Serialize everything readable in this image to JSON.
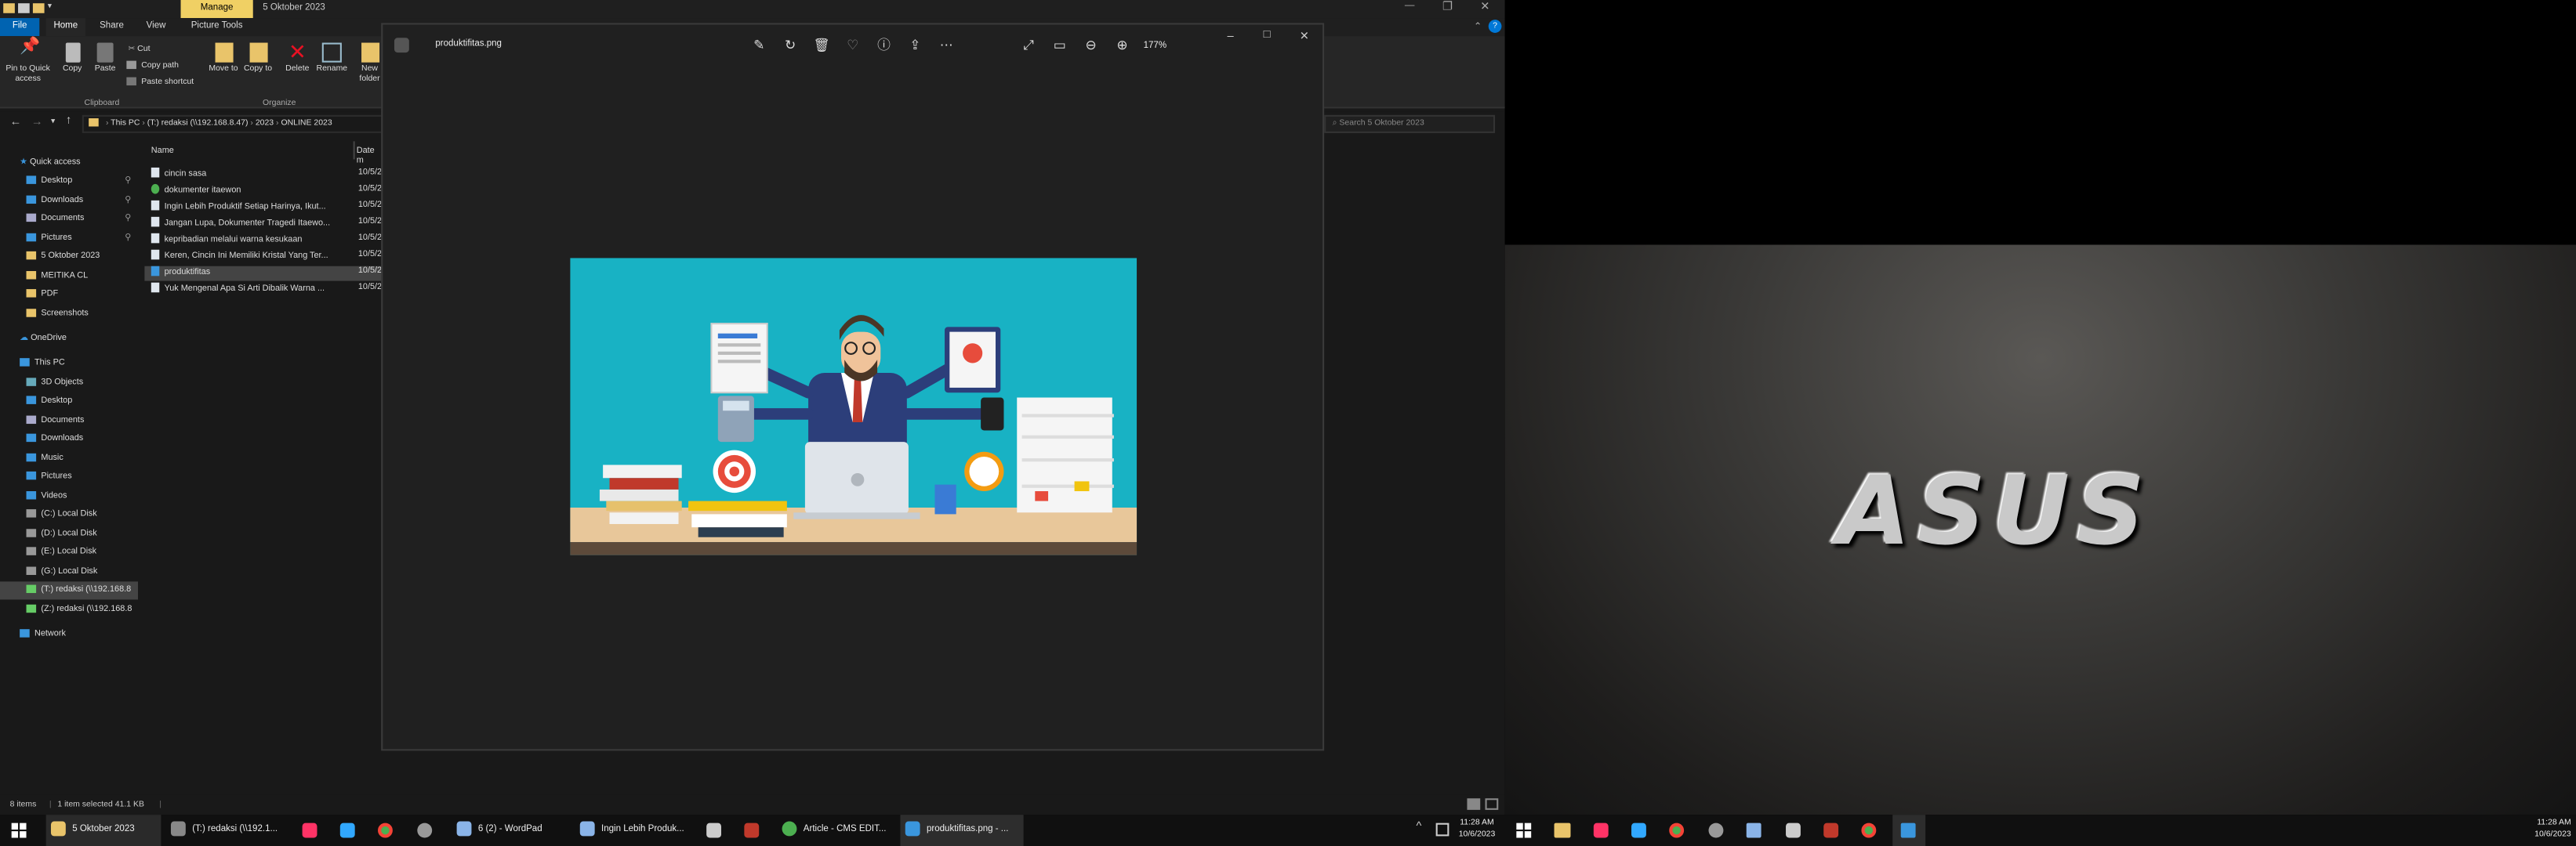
{
  "explorer": {
    "title": "5 Oktober 2023",
    "manage_tab": "Manage",
    "tabs": [
      "File",
      "Home",
      "Share",
      "View",
      "Picture Tools"
    ],
    "ribbon": {
      "pin": "Pin to Quick access",
      "copy": "Copy",
      "paste": "Paste",
      "cut": "Cut",
      "copy_path": "Copy path",
      "paste_shortcut": "Paste shortcut",
      "move_to": "Move to",
      "copy_to": "Copy to",
      "delete": "Delete",
      "rename": "Rename",
      "new_folder": "New folder",
      "group_clipboard": "Clipboard",
      "group_organize": "Organize"
    },
    "breadcrumb": [
      "This PC",
      "(T:) redaksi (\\\\192.168.8.47)",
      "2023",
      "ONLINE 2023"
    ],
    "search_placeholder": "Search 5 Oktober 2023",
    "nav": {
      "quick_access": "Quick access",
      "quick_items": [
        "Desktop",
        "Downloads",
        "Documents",
        "Pictures",
        "5 Oktober 2023",
        "MEITIKA CL",
        "PDF",
        "Screenshots"
      ],
      "onedrive": "OneDrive",
      "this_pc": "This PC",
      "pc_items": [
        "3D Objects",
        "Desktop",
        "Documents",
        "Downloads",
        "Music",
        "Pictures",
        "Videos",
        "(C:) Local Disk",
        "(D:) Local Disk",
        "(E:) Local Disk",
        "(G:) Local Disk",
        "(T:) redaksi (\\\\192.168.8",
        "(Z:) redaksi (\\\\192.168.8"
      ],
      "network": "Network"
    },
    "columns": {
      "name": "Name",
      "date": "Date m"
    },
    "files": [
      {
        "name": "cincin sasa",
        "date": "10/5/2",
        "icon": "doc-icon"
      },
      {
        "name": "dokumenter itaewon",
        "date": "10/5/2",
        "icon": "chrome-icon"
      },
      {
        "name": "Ingin Lebih Produktif Setiap Harinya, Ikut...",
        "date": "10/5/2",
        "icon": "doc-icon"
      },
      {
        "name": "Jangan Lupa, Dokumenter Tragedi Itaewo...",
        "date": "10/5/2",
        "icon": "doc-icon"
      },
      {
        "name": "kepribadian melalui warna kesukaan",
        "date": "10/5/2",
        "icon": "doc-icon"
      },
      {
        "name": "Keren, Cincin Ini Memiliki Kristal Yang Ter...",
        "date": "10/5/2",
        "icon": "doc-icon"
      },
      {
        "name": "produktifitas",
        "date": "10/5/2",
        "icon": "image-icon"
      },
      {
        "name": "Yuk Mengenal Apa Si Arti Dibalik Warna ...",
        "date": "10/5/2",
        "icon": "doc-icon"
      }
    ],
    "status": {
      "items": "8 items",
      "selected": "1 item selected  41.1 KB"
    }
  },
  "viewer": {
    "filename": "produktifitas.png",
    "zoom": "177%"
  },
  "taskbar": {
    "items": [
      "5 Oktober 2023",
      "(T:) redaksi (\\\\192.1...",
      "6 (2) - WordPad",
      "Ingin Lebih Produk...",
      "Article - CMS EDIT...",
      "produktifitas.png - ..."
    ],
    "time": "11:28 AM",
    "date": "10/6/2023"
  },
  "wallpaper_brand": "ASUS",
  "colors": {
    "accent": "#0078d7",
    "manage_tab": "#f0d064",
    "illustration_bg": "#18b2c4"
  }
}
